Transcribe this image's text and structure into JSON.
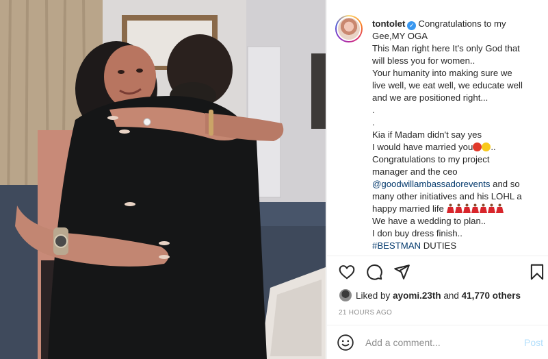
{
  "post": {
    "photo_alt": "photo",
    "username": "tontolet",
    "caption_lines": [
      "Congratulations to my",
      "Gee,MY OGA",
      "This Man right here It's only God that",
      "will bless you for women..",
      "Your humanity into making sure we",
      "live well, we eat well, we educate well",
      "and we are positioned right...",
      ".",
      ".",
      "Kia if Madam didn't say yes",
      "I would have married you",
      "..",
      "Congratulations to my project",
      "manager and the ceo",
      "@goodwillambassadorevents",
      " and so",
      "many other initiatives and his LOHL a",
      "happy married life",
      "We have a wedding to plan..",
      "I don buy dress finish..",
      "#BESTMAN",
      " DUTIES"
    ],
    "likes_prefix": "Liked by",
    "liked_by_user": "ayomi.23th",
    "likes_suffix": "and",
    "likes_count": "41,770 others",
    "timestamp": "21 HOURS AGO"
  },
  "icons": {
    "like": "heart-icon",
    "comment": "comment-icon",
    "share": "share-icon",
    "save": "bookmark-icon",
    "emoji": "smiley-icon",
    "verified": "verified-badge-icon"
  },
  "comment_box": {
    "placeholder": "Add a comment...",
    "post_label": "Post"
  },
  "colors": {
    "link": "#00376b",
    "verified": "#3897f0",
    "post_disabled": "#b2dffc",
    "muted": "#8e8e8e"
  }
}
